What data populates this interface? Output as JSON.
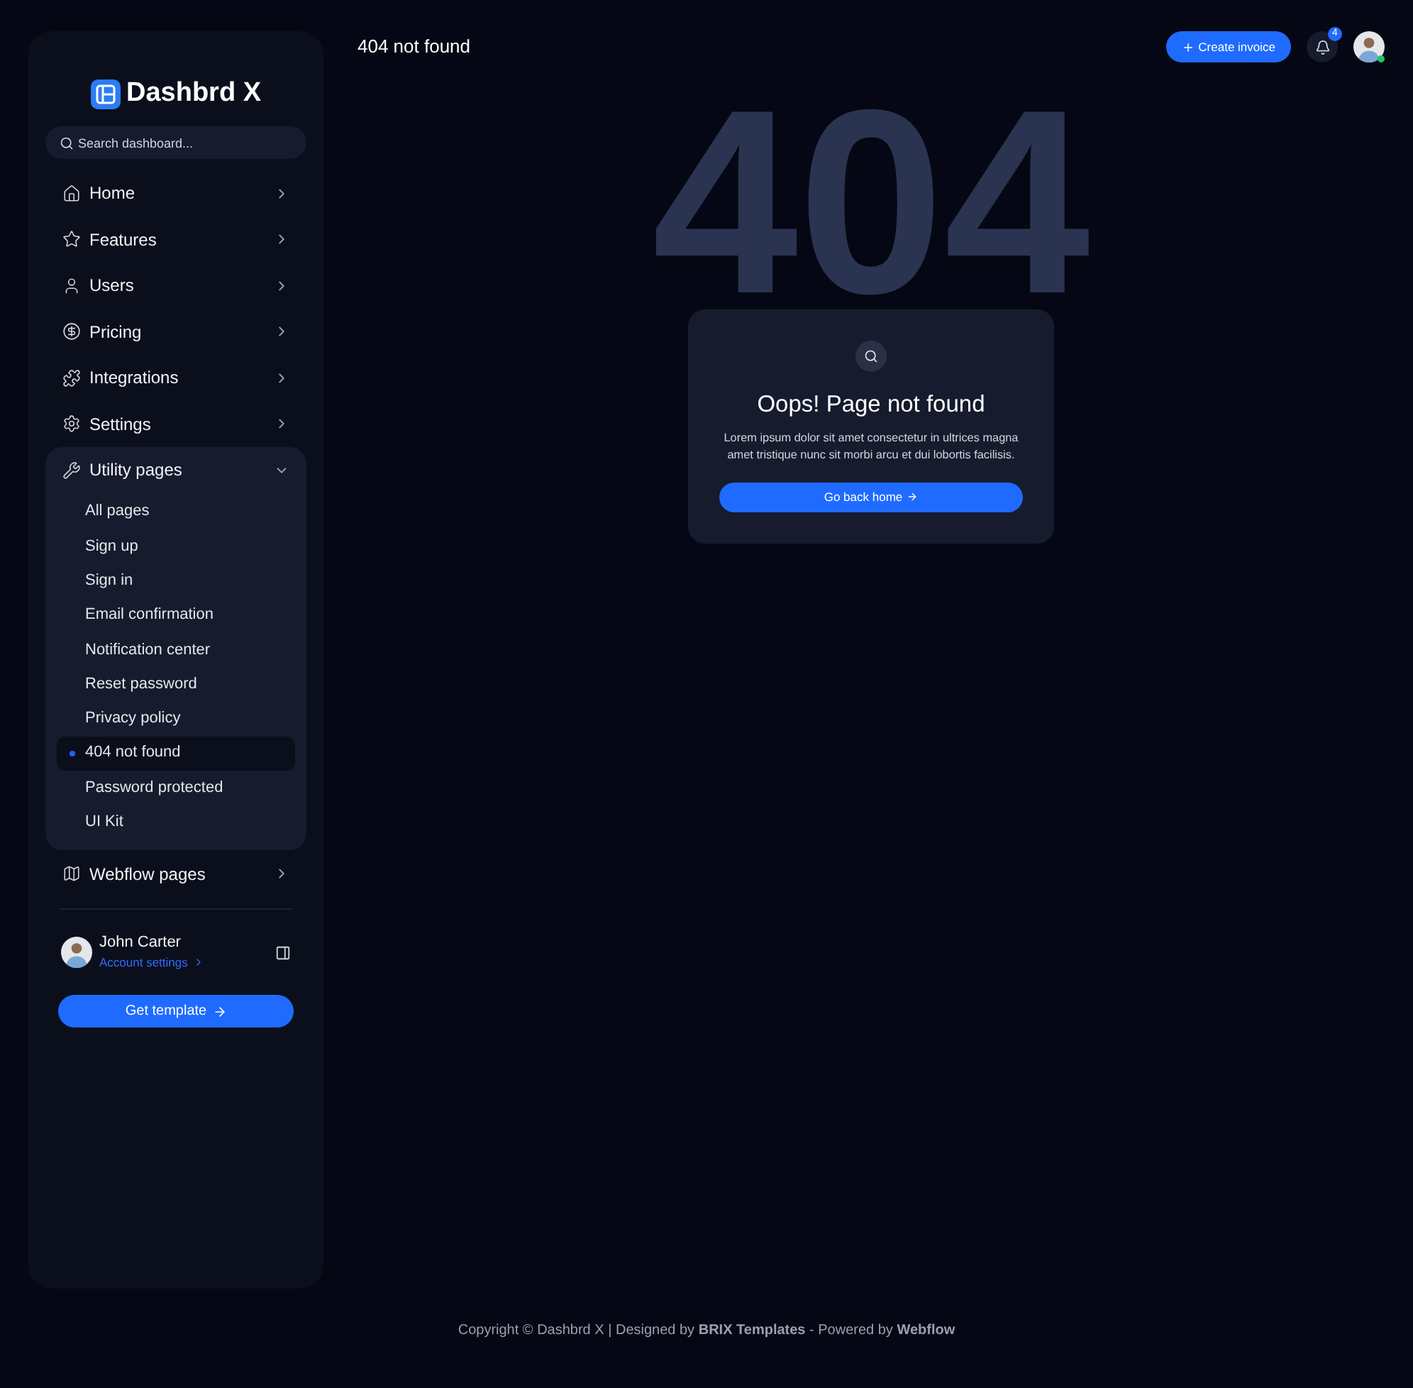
{
  "sidebar": {
    "logo": "Dashbrd X",
    "search": {
      "placeholder": "Search dashboard..."
    },
    "nav": [
      {
        "label": "Home",
        "expanded": false
      },
      {
        "label": "Features",
        "expanded": false
      },
      {
        "label": "Users",
        "expanded": false
      },
      {
        "label": "Pricing",
        "expanded": false
      },
      {
        "label": "Integrations",
        "expanded": false
      },
      {
        "label": "Settings",
        "expanded": false
      },
      {
        "label": "Utility pages",
        "expanded": true,
        "children": [
          {
            "label": "All pages",
            "selected": false
          },
          {
            "label": "Sign up",
            "selected": false
          },
          {
            "label": "Sign in",
            "selected": false
          },
          {
            "label": "Email confirmation",
            "selected": false
          },
          {
            "label": "Notification center",
            "selected": false
          },
          {
            "label": "Reset password",
            "selected": false
          },
          {
            "label": "Privacy policy",
            "selected": false
          },
          {
            "label": "404 not found",
            "selected": true
          },
          {
            "label": "Password protected",
            "selected": false
          },
          {
            "label": "UI Kit",
            "selected": false
          }
        ]
      },
      {
        "label": "Webflow pages",
        "expanded": false
      }
    ],
    "user": {
      "name": "John Carter",
      "link": "Account settings"
    },
    "cta": "Get template"
  },
  "header": {
    "title": "404 not found",
    "create_button": "Create invoice",
    "notifications": "4"
  },
  "backdrop_text": "404",
  "card": {
    "title": "Oops! Page not found",
    "text": "Lorem ipsum dolor sit amet consectetur in ultrices magna amet tristique nunc sit morbi arcu et dui lobortis facilisis.",
    "button": "Go back home"
  },
  "footer": "Copyright © Dashbrd X | Designed by **BRIX Templates** - Powered by **Webflow**"
}
